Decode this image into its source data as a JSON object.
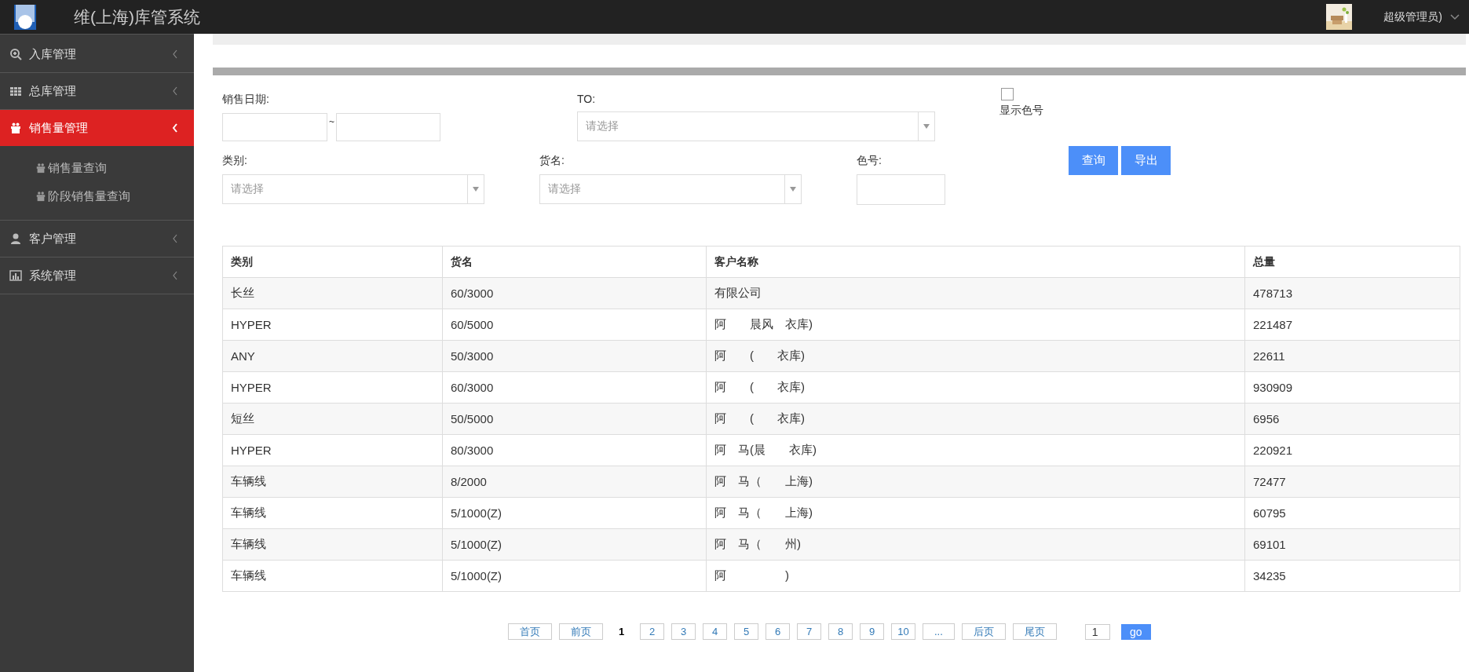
{
  "header": {
    "title": "维(上海)库管系统",
    "user": "超级管理员)"
  },
  "sidebar": {
    "items": [
      {
        "label": "入库管理",
        "kind": "search",
        "selected": false,
        "expanded": false
      },
      {
        "label": "总库管理",
        "kind": "grid",
        "selected": false,
        "expanded": false
      },
      {
        "label": "销售量管理",
        "kind": "gift",
        "selected": true,
        "expanded": true,
        "children": [
          {
            "label": "销售量查询",
            "kind": "gift"
          },
          {
            "label": "阶段销售量查询",
            "kind": "gift"
          }
        ]
      },
      {
        "label": "客户管理",
        "kind": "user",
        "selected": false,
        "expanded": false
      },
      {
        "label": "系统管理",
        "kind": "chart",
        "selected": false,
        "expanded": false
      }
    ]
  },
  "filters": {
    "date_label": "销售日期:",
    "date_separator": "~",
    "to_label": "TO:",
    "to_placeholder": "请选择",
    "show_color": {
      "label": "显示色号",
      "checked": false
    },
    "category_label": "类别:",
    "category_placeholder": "请选择",
    "goods_label": "货名:",
    "goods_placeholder": "请选择",
    "color_label": "色号:",
    "buttons": [
      "查询",
      "导出"
    ]
  },
  "table": {
    "columns": [
      "类别",
      "货名",
      "客户名称",
      "总量"
    ],
    "rows": [
      [
        "长丝",
        "60/3000",
        "有限公司",
        "478713"
      ],
      [
        "HYPER",
        "60/5000",
        "阿　　晨风　衣库)",
        "221487"
      ],
      [
        "ANY",
        "50/3000",
        "阿　　(　　衣库)",
        "22611"
      ],
      [
        "HYPER",
        "60/3000",
        "阿　　(　　衣库)",
        "930909"
      ],
      [
        "短丝",
        "50/5000",
        "阿　　(　　衣库)",
        "6956"
      ],
      [
        "HYPER",
        "80/3000",
        "阿　马(晨　　衣库)",
        "220921"
      ],
      [
        "车辆线",
        "8/2000",
        "阿　马（　　上海)",
        "72477"
      ],
      [
        "车辆线",
        "5/1000(Z)",
        "阿　马（　　上海)",
        "60795"
      ],
      [
        "车辆线",
        "5/1000(Z)",
        "阿　马（　　州)",
        "69101"
      ],
      [
        "车辆线",
        "5/1000(Z)",
        "阿　　　　　)",
        "34235"
      ]
    ]
  },
  "pagination": {
    "first": "首页",
    "prev": "前页",
    "pages": [
      {
        "label": "1",
        "selected": true
      },
      {
        "label": "2",
        "selected": false
      },
      {
        "label": "3",
        "selected": false
      },
      {
        "label": "4",
        "selected": false
      },
      {
        "label": "5",
        "selected": false
      },
      {
        "label": "6",
        "selected": false
      },
      {
        "label": "7",
        "selected": false
      },
      {
        "label": "8",
        "selected": false
      },
      {
        "label": "9",
        "selected": false
      },
      {
        "label": "10",
        "selected": false
      }
    ],
    "ellipsis": "...",
    "next": "后页",
    "last": "尾页",
    "jump_value": "1",
    "go": "go"
  }
}
